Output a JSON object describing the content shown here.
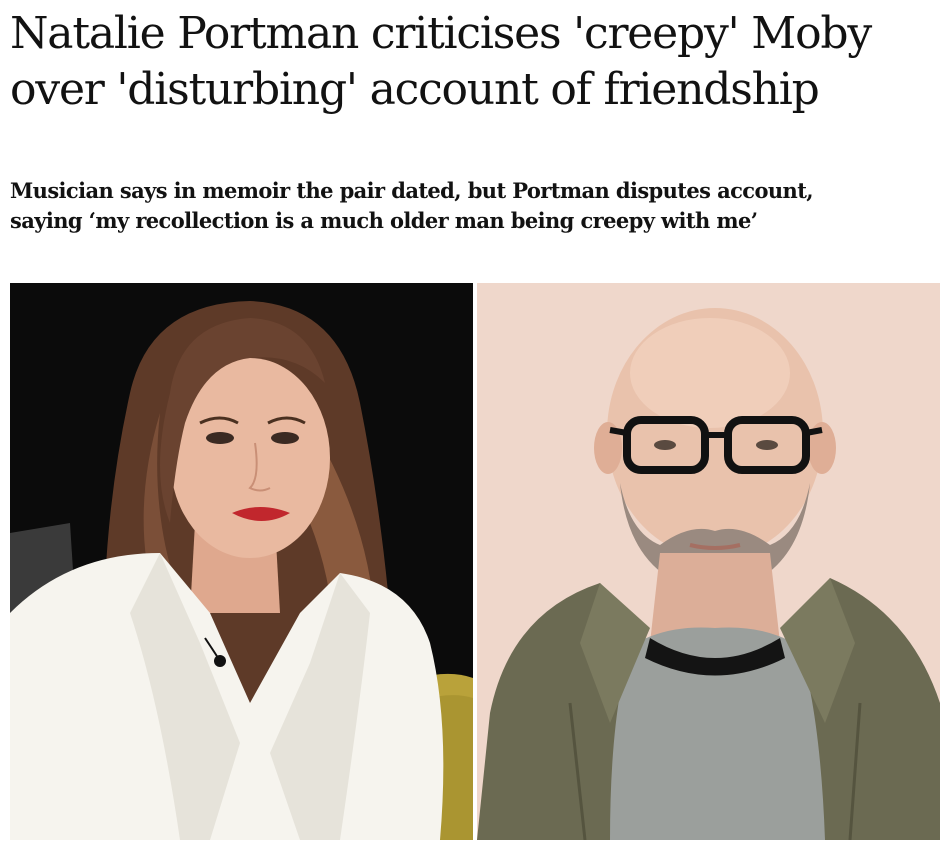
{
  "article": {
    "headline": "Natalie Portman criticises 'creepy' Moby over 'disturbing' account of friendship",
    "standfirst": "Musician says in memoir the pair dated, but Portman disputes account, saying ‘my recollection is a much older man being creepy with me’"
  },
  "image": {
    "panels": [
      "left-portrait",
      "right-portrait"
    ],
    "colors": {
      "left_background": "#0b0b0b",
      "right_background": "#efd7cb",
      "blazer": "#f6f4ee",
      "jacket": "#6b6a52",
      "hair": "#6a4330",
      "skin": "#e9b9a0"
    }
  }
}
